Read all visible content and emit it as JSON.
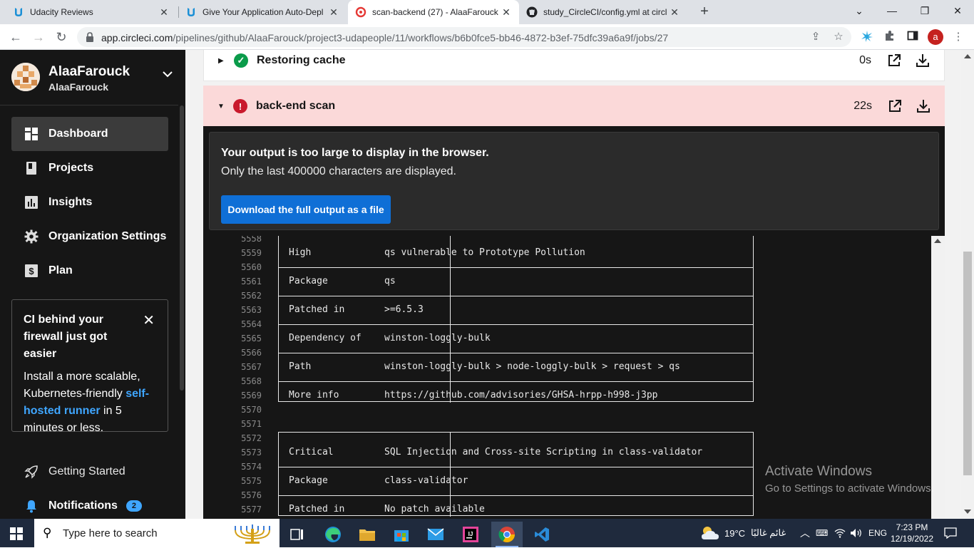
{
  "browser": {
    "tabs": [
      {
        "title": "Udacity Reviews",
        "favicon": "udacity-icon"
      },
      {
        "title": "Give Your Application Auto-Depl",
        "favicon": "udacity-icon"
      },
      {
        "title": "scan-backend (27) - AlaaFarouck",
        "favicon": "circleci-icon",
        "active": true
      },
      {
        "title": "study_CircleCI/config.yml at circl",
        "favicon": "github-icon"
      }
    ],
    "url_host": "app.circleci.com",
    "url_path": "/pipelines/github/AlaaFarouck/project3-udapeople/11/workflows/b6b0fce5-bb46-4872-b3ef-75dfc39a6a9f/jobs/27",
    "profile_initial": "a"
  },
  "sidebar": {
    "org_name": "AlaaFarouck",
    "org_sub": "AlaaFarouck",
    "nav": [
      {
        "label": "Dashboard",
        "icon": "dashboard-icon"
      },
      {
        "label": "Projects",
        "icon": "projects-icon"
      },
      {
        "label": "Insights",
        "icon": "insights-icon"
      },
      {
        "label": "Organization Settings",
        "icon": "gear-icon"
      },
      {
        "label": "Plan",
        "icon": "dollar-icon"
      }
    ],
    "promo": {
      "title": "CI behind your firewall just got easier",
      "body_pre": "Install a more scalable, Kubernetes-friendly ",
      "body_link": "self-hosted runner",
      "body_post": " in 5 minutes or less."
    },
    "getting_started": "Getting Started",
    "notifications": "Notifications",
    "notifications_count": "2"
  },
  "steps": [
    {
      "name": "Restoring cache",
      "time": "0s",
      "status": "success"
    },
    {
      "name": "back-end scan",
      "time": "22s",
      "status": "failed"
    }
  ],
  "output_notice": {
    "title": "Your output is too large to display in the browser.",
    "body": "Only the last 400000 characters are displayed.",
    "button": "Download the full output as a file"
  },
  "log": {
    "line_numbers": [
      "5558",
      "5559",
      "5560",
      "5561",
      "5562",
      "5563",
      "5564",
      "5565",
      "5566",
      "5567",
      "5568",
      "5569",
      "5570",
      "5571",
      "5572",
      "5573",
      "5574",
      "5575",
      "5576",
      "5577"
    ],
    "table1": [
      {
        "key": "High",
        "value": "qs vulnerable to Prototype Pollution"
      },
      {
        "key": "Package",
        "value": "qs"
      },
      {
        "key": "Patched in",
        "value": ">=6.5.3"
      },
      {
        "key": "Dependency of",
        "value": "winston-loggly-bulk"
      },
      {
        "key": "Path",
        "value": "winston-loggly-bulk > node-loggly-bulk > request > qs"
      },
      {
        "key": "More info",
        "value": "https://github.com/advisories/GHSA-hrpp-h998-j3pp"
      }
    ],
    "table2": [
      {
        "key": "Critical",
        "value": "SQL Injection and Cross-site Scripting in class-validator"
      },
      {
        "key": "Package",
        "value": "class-validator"
      },
      {
        "key": "Patched in",
        "value": "No patch available"
      }
    ]
  },
  "watermark": {
    "line1": "Activate Windows",
    "line2": "Go to Settings to activate Windows."
  },
  "taskbar": {
    "search_placeholder": "Type here to search",
    "weather": "19°C",
    "weather_desc": "غائم غالبًا",
    "language": "ENG",
    "time": "7:23 PM",
    "date": "12/19/2022"
  }
}
